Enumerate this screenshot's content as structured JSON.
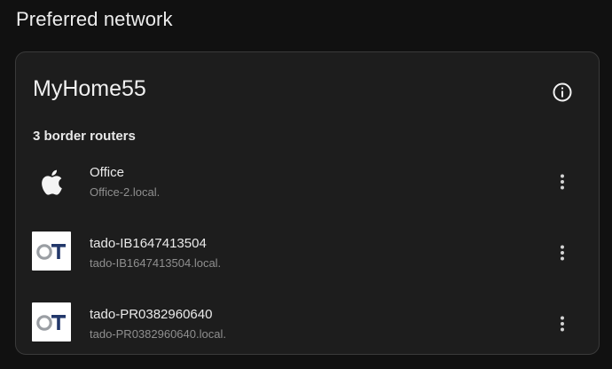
{
  "section": {
    "title": "Preferred network"
  },
  "network": {
    "name": "MyHome55",
    "info_icon": "info-icon",
    "routers_label": "3 border routers"
  },
  "routers": [
    {
      "name": "Office",
      "host": "Office-2.local.",
      "logo": "apple-logo-icon"
    },
    {
      "name": "tado-IB1647413504",
      "host": "tado-IB1647413504.local.",
      "logo": "openthread-logo-icon"
    },
    {
      "name": "tado-PR0382960640",
      "host": "tado-PR0382960640.local.",
      "logo": "openthread-logo-icon"
    }
  ],
  "colors": {
    "background": "#111111",
    "card": "#1d1d1d",
    "card_border": "#3a3a3a",
    "primary_text": "#eaeaea",
    "secondary_text": "#8f8f8f",
    "ot_logo_grey": "#9a9ea3",
    "ot_logo_blue": "#23386b"
  }
}
